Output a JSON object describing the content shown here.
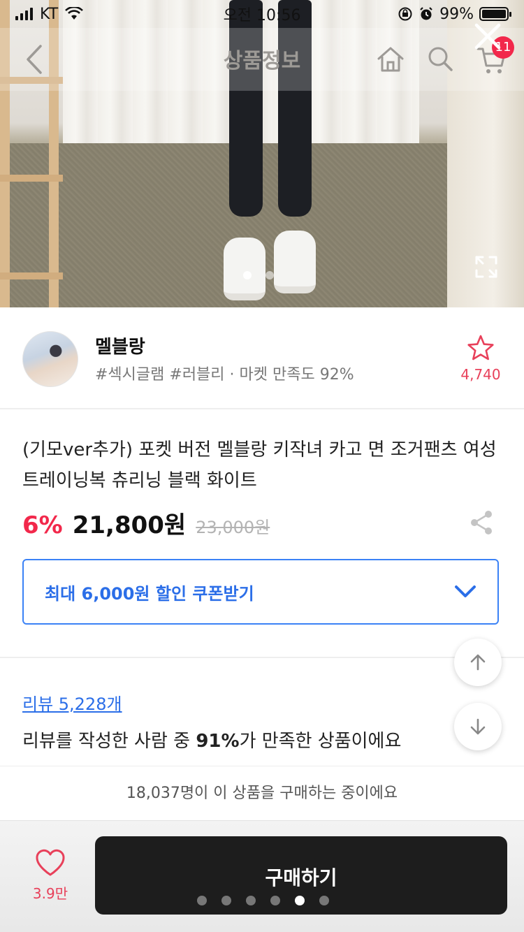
{
  "status_bar": {
    "carrier": "KT",
    "time": "오전 10:56",
    "battery": "99%"
  },
  "nav": {
    "title": "상품정보",
    "cart_badge": "11"
  },
  "hero": {
    "image_index": 1,
    "image_count": 2
  },
  "store": {
    "name": "멜블랑",
    "tags": "#섹시글램 #러블리 · 마켓 만족도 92%",
    "favorite_count": "4,740"
  },
  "product": {
    "title": "(기모ver추가) 포켓 버전 멜블랑 키작녀 카고 면 조거팬츠 여성 트레이닝복 츄리닝 블랙 화이트",
    "discount": "6%",
    "price": "21,800원",
    "original_price": "23,000원"
  },
  "coupon": {
    "label": "최대 6,000원 할인 쿠폰받기"
  },
  "reviews": {
    "link": "리뷰 5,228개",
    "summary_prefix": "리뷰를 작성한 사람 중 ",
    "summary_percent": "91%",
    "summary_suffix": "가 만족한 상품이에요"
  },
  "buying_now": "18,037명이 이 상품을 구매하는 중이에요",
  "bottom": {
    "like_count": "3.9만",
    "buy_label": "구매하기",
    "page_dots_count": 6,
    "page_dots_active": 5
  },
  "colors": {
    "accent_red": "#f2284b",
    "link_blue": "#2b6ee8",
    "buy_button": "#1d1d1d"
  },
  "icons": [
    "back-arrow-icon",
    "home-icon",
    "search-icon",
    "cart-icon",
    "close-icon",
    "expand-icon",
    "star-icon",
    "share-icon",
    "chevron-down-icon",
    "arrow-up-icon",
    "arrow-down-icon",
    "heart-icon",
    "wifi-icon",
    "signal-icon",
    "battery-icon",
    "orientation-lock-icon",
    "alarm-icon"
  ]
}
